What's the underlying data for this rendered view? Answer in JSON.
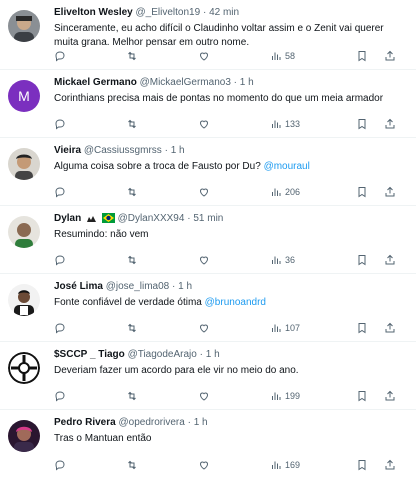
{
  "tweets": [
    {
      "name": "Elivelton Wesley",
      "handle": "@_Elivelton19",
      "time": "42 min",
      "text": "Sinceramente, eu acho difícil o Claudinho voltar assim e o Zenit vai querer",
      "text2": "muita grana. Melhor pensar em outro nome.",
      "views": "58"
    },
    {
      "name": "Mickael Germano",
      "handle": "@MickaelGermano3",
      "time": "1 h",
      "text": "Corinthians precisa mais de pontas no momento do que um meia armador",
      "avatar_letter": "M",
      "views": "133"
    },
    {
      "name": "Vieira",
      "handle": "@Cassiussgmrss",
      "time": "1 h",
      "text": "Alguma coisa sobre a troca de Fausto por Du? ",
      "mention": "@mouraul",
      "views": "206"
    },
    {
      "name": "Dylan",
      "handle": "@DylanXXX94",
      "time": "51 min",
      "text": "Resumindo: não vem",
      "views": "36"
    },
    {
      "name": "José Lima",
      "handle": "@jose_lima08",
      "time": "1 h",
      "text": "Fonte confiável  de verdade ótima ",
      "mention": "@brunoandrd",
      "views": "107"
    },
    {
      "name": "$SCCP _ Tiago",
      "handle": "@TiagodeArajo",
      "time": "1 h",
      "text": "Deveriam fazer um acordo para ele vir no meio do ano.",
      "views": "199"
    },
    {
      "name": "Pedro Rivera",
      "handle": "@opedrorivera",
      "time": "1 h",
      "text": "Tras o Mantuan então",
      "views": "169"
    }
  ],
  "separator": "·",
  "icons": [
    "reply-icon",
    "retweet-icon",
    "like-icon",
    "views-icon",
    "bookmark-icon",
    "share-icon"
  ],
  "colors": {
    "accent": "#1d9bf0",
    "muted": "#536471",
    "text": "#0f1419",
    "avatar_purple": "#7b2fbf"
  }
}
